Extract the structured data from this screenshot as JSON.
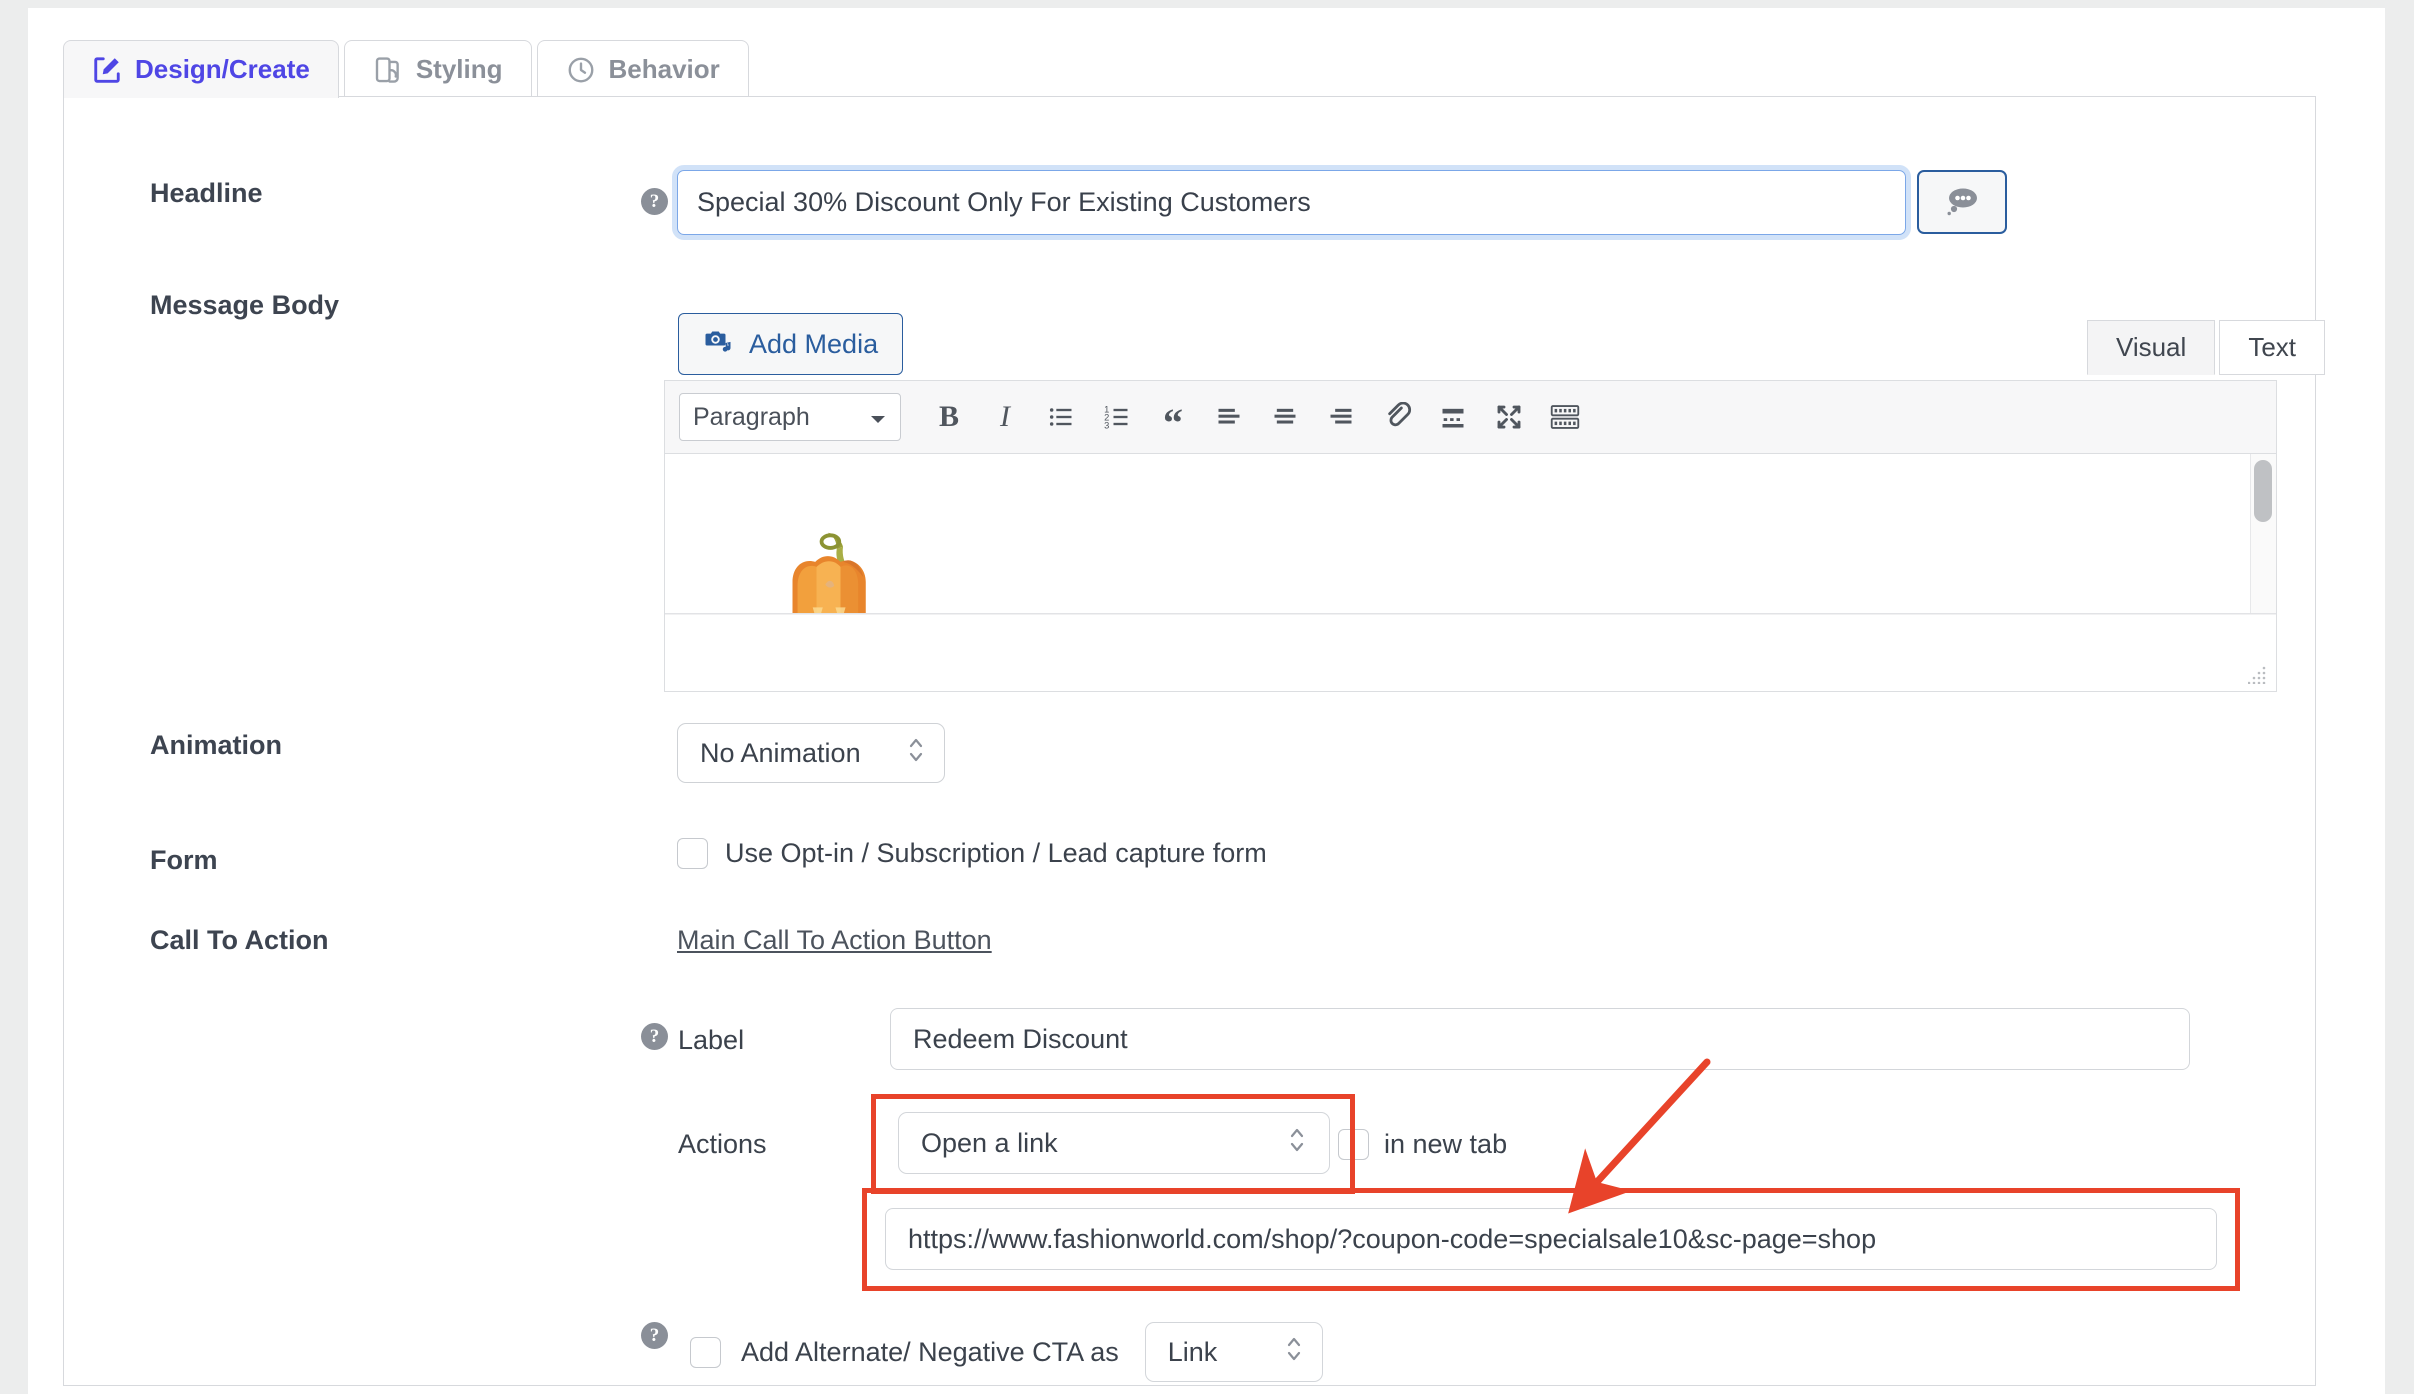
{
  "tabs": [
    {
      "label": "Design/Create",
      "icon": "edit-square-icon",
      "active": true
    },
    {
      "label": "Styling",
      "icon": "layers-icon",
      "active": false
    },
    {
      "label": "Behavior",
      "icon": "clock-icon",
      "active": false
    }
  ],
  "form": {
    "headline": {
      "label": "Headline",
      "value": "Special 30% Discount Only For Existing Customers",
      "help": "?",
      "comment_icon": "speech-bubble-icon"
    },
    "message_body": {
      "label": "Message Body",
      "add_media_label": "Add Media",
      "add_media_icon": "media-icon",
      "view_tabs": [
        {
          "label": "Visual",
          "active": true
        },
        {
          "label": "Text",
          "active": false
        }
      ],
      "toolbar": {
        "format_select": "Paragraph",
        "buttons": [
          {
            "name": "bold-icon",
            "glyph": "B"
          },
          {
            "name": "italic-icon",
            "glyph": "I"
          },
          {
            "name": "bulleted-list-icon",
            "glyph": ""
          },
          {
            "name": "numbered-list-icon",
            "glyph": ""
          },
          {
            "name": "blockquote-icon",
            "glyph": "“"
          },
          {
            "name": "align-left-icon",
            "glyph": ""
          },
          {
            "name": "align-center-icon",
            "glyph": ""
          },
          {
            "name": "align-right-icon",
            "glyph": ""
          },
          {
            "name": "insert-link-icon",
            "glyph": ""
          },
          {
            "name": "read-more-icon",
            "glyph": ""
          },
          {
            "name": "fullscreen-icon",
            "glyph": ""
          },
          {
            "name": "keyboard-shortcuts-icon",
            "glyph": ""
          }
        ]
      },
      "content_image": "pumpkin-image"
    },
    "animation": {
      "label": "Animation",
      "value": "No Animation"
    },
    "form_section": {
      "label": "Form",
      "checkbox_label": "Use Opt-in / Subscription / Lead capture form",
      "checked": false
    },
    "call_to_action": {
      "label": "Call To Action",
      "main_button_link": "Main Call To Action Button",
      "cta_label": {
        "label": "Label",
        "help": "?",
        "value": "Redeem Discount"
      },
      "actions": {
        "label": "Actions",
        "value": "Open a link",
        "new_tab_label": "in new tab",
        "new_tab_checked": false,
        "url": "https://www.fashionworld.com/shop/?coupon-code=specialsale10&sc-page=shop"
      },
      "alternate_cta": {
        "help": "?",
        "label": "Add Alternate/ Negative CTA as",
        "checked": false,
        "type_value": "Link"
      }
    }
  },
  "annotations": {
    "color": "#e8432a",
    "highlight_actions_select": true,
    "highlight_url_input": true,
    "arrow_points_to": "url-input"
  },
  "colors": {
    "accent": "#4f46e5",
    "link_blue": "#2a5d9e",
    "annotation_red": "#e8432a",
    "text": "#3b424c"
  }
}
